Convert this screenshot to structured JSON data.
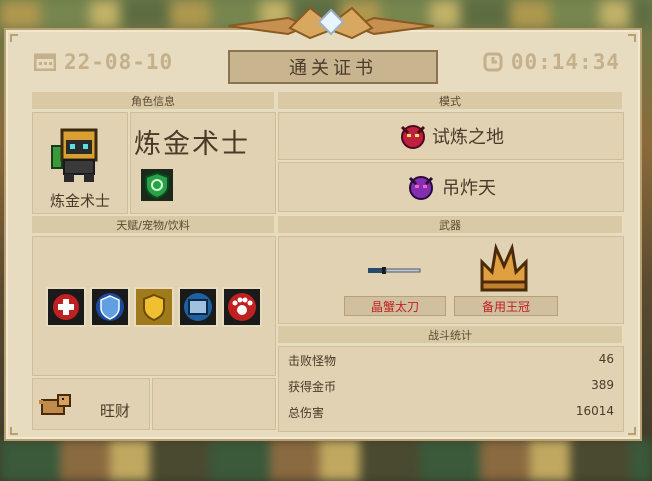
{
  "header": {
    "date": "22-08-10",
    "title": "通关证书",
    "time": "00:14:34"
  },
  "character": {
    "section_label": "角色信息",
    "name": "炼金术士",
    "portrait_caption": "炼金术士"
  },
  "mode": {
    "section_label": "模式",
    "primary": "试炼之地",
    "secondary": "吊炸天"
  },
  "talents": {
    "section_label": "天赋/宠物/饮料",
    "items": [
      "health-cross-icon",
      "shield-wing-icon",
      "gold-shield-icon",
      "tablet-icon",
      "paw-icon"
    ]
  },
  "weapons": {
    "section_label": "武器",
    "items": [
      {
        "name": "晶蟹太刀",
        "icon": "katana-icon"
      },
      {
        "name": "备用王冠",
        "icon": "crown-icon"
      }
    ]
  },
  "stats": {
    "section_label": "战斗统计",
    "rows": [
      {
        "label": "击败怪物",
        "value": "46"
      },
      {
        "label": "获得金币",
        "value": "389"
      },
      {
        "label": "总伤害",
        "value": "16014"
      }
    ]
  },
  "pet": {
    "name": "旺财",
    "icon": "dog-pet-icon"
  },
  "colors": {
    "paper": "#e8dcc0",
    "header_bar": "#d9c9a4",
    "text": "#4a3a2a",
    "weapon_red": "#c02020"
  }
}
